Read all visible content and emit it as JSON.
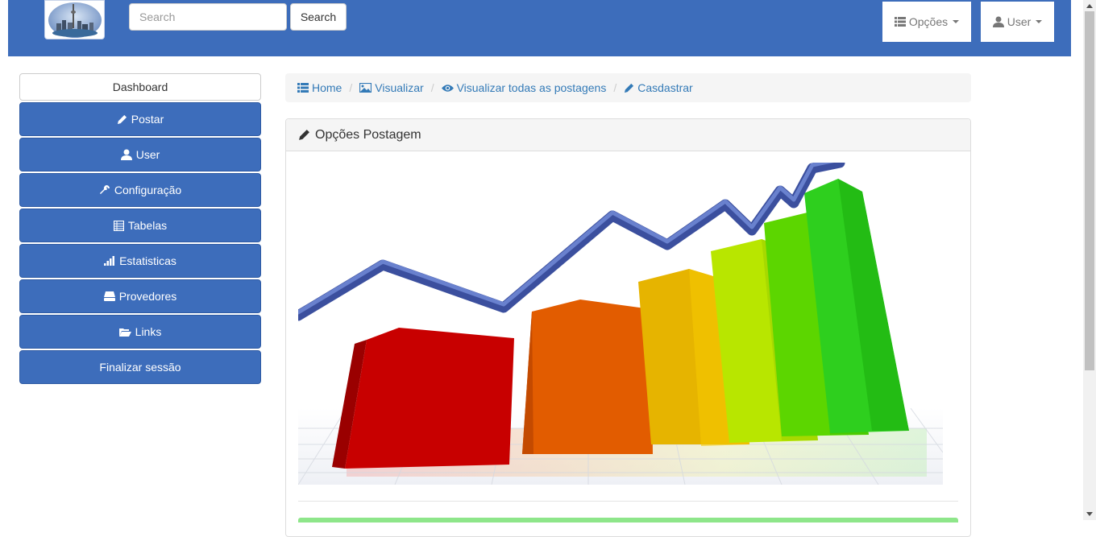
{
  "navbar": {
    "search_placeholder": "Search",
    "search_button": "Search",
    "opcoes_label": "Opções",
    "user_label": "User",
    "bg_color": "#3d6dbb"
  },
  "sidebar": {
    "items": [
      {
        "label": "Dashboard",
        "icon": "",
        "active": true
      },
      {
        "label": "Postar",
        "icon": "pencil-icon"
      },
      {
        "label": "User",
        "icon": "user-icon"
      },
      {
        "label": "Configuração",
        "icon": "wrench-icon"
      },
      {
        "label": "Tabelas",
        "icon": "table-icon"
      },
      {
        "label": "Estatisticas",
        "icon": "signal-icon"
      },
      {
        "label": "Provedores",
        "icon": "hdd-icon"
      },
      {
        "label": "Links",
        "icon": "folder-open-icon"
      },
      {
        "label": "Finalizar sessão",
        "icon": ""
      }
    ]
  },
  "breadcrumb": {
    "items": [
      {
        "label": "Home",
        "icon": "list-icon"
      },
      {
        "label": "Visualizar",
        "icon": "picture-icon"
      },
      {
        "label": "Visualizar todas as postagens",
        "icon": "eye-icon"
      },
      {
        "label": "Casdastrar",
        "icon": "pencil-icon"
      }
    ]
  },
  "panel": {
    "title": "Opções Postagem",
    "image_icon": "bar-chart-growth-illustration"
  }
}
